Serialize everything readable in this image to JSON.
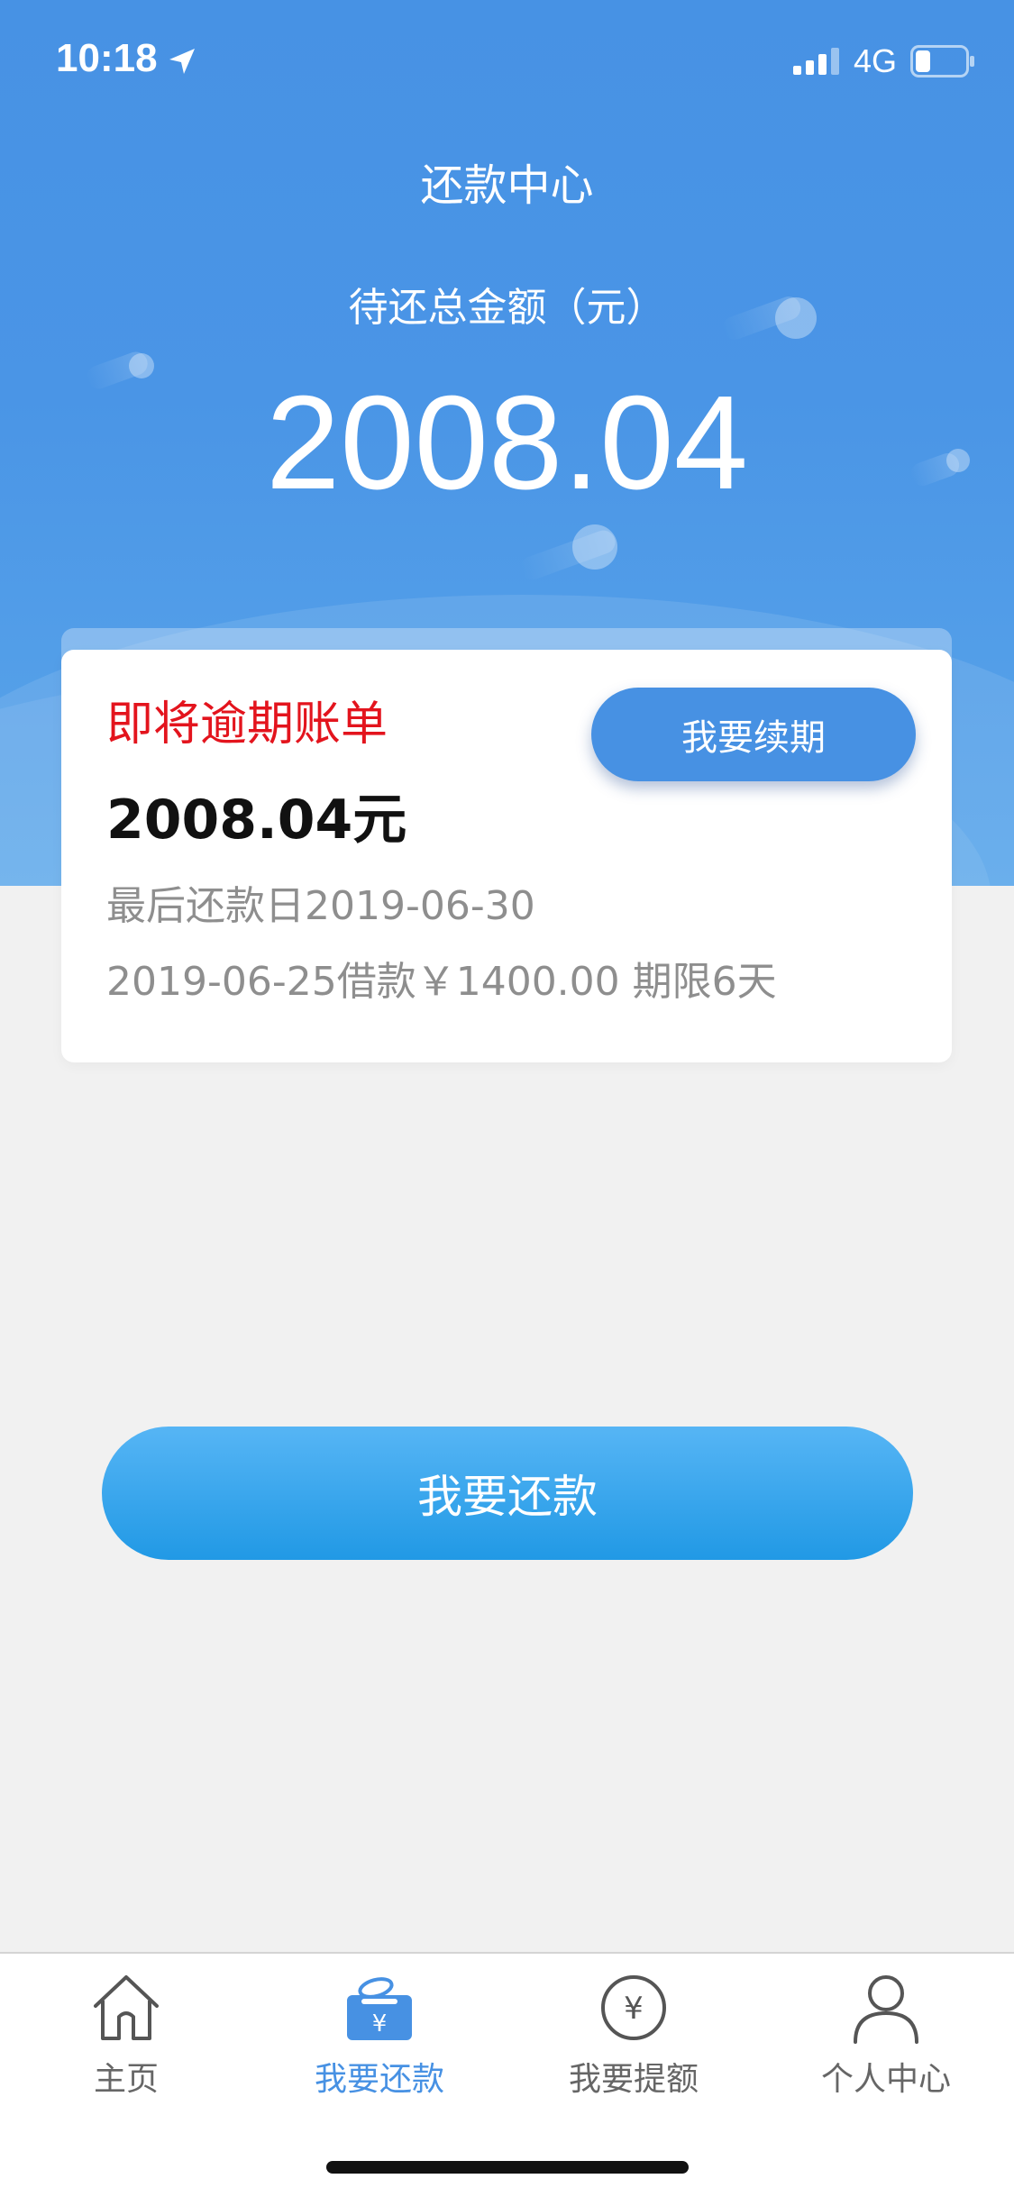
{
  "status_bar": {
    "time": "10:18",
    "network": "4G"
  },
  "header": {
    "title": "还款中心",
    "total_label": "待还总金额（元）",
    "total_amount": "2008.04"
  },
  "bill_card": {
    "title": "即将逾期账单",
    "amount": "2008.04元",
    "renew_label": "我要续期",
    "due_date": "最后还款日2019-06-30",
    "loan_info": "2019-06-25借款￥1400.00 期限6天"
  },
  "repay_button_label": "我要还款",
  "tab_bar": {
    "items": [
      {
        "label": "主页",
        "icon": "home-icon",
        "active": false
      },
      {
        "label": "我要还款",
        "icon": "repay-wallet-icon",
        "active": true
      },
      {
        "label": "我要提额",
        "icon": "yuan-circle-icon",
        "active": false
      },
      {
        "label": "个人中心",
        "icon": "user-icon",
        "active": false
      }
    ]
  },
  "colors": {
    "primary_blue": "#4791e3",
    "header_blue": "#4792e4",
    "warning_red": "#e3141d",
    "background": "#f1f1f1",
    "secondary_text": "#8e8e8e"
  }
}
